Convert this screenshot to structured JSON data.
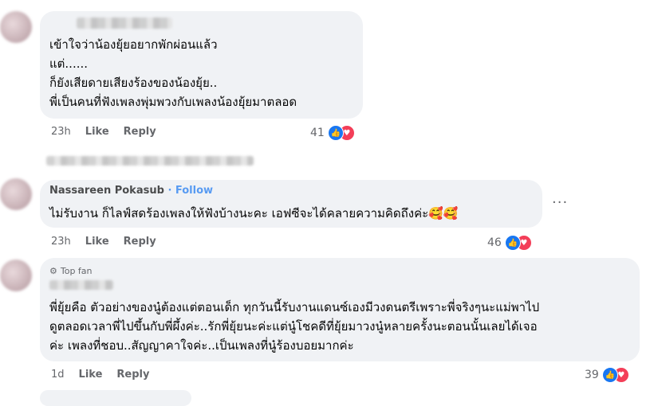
{
  "comments": [
    {
      "text": "เข้าใจว่าน้องยุ้ยอยากพักผ่อนแล้ว\nแต่......\nก็ยังเสียดายเสียงร้องของน้องยุ้ย..\nพี่เป็นคนที่ฟังเพลงพุ่มพวงกับเพลงน้องยุ้ยมาตลอด",
      "time": "23h",
      "like_label": "Like",
      "reply_label": "Reply",
      "reaction_count": "41"
    },
    {
      "author": "Nassareen Pokasub",
      "follow_label": "· Follow",
      "text": "ไม่รับงาน ก็ไลฟ์สดร้องเพลงให้ฟังบ้างนะคะ เอฟซีจะได้คลายความคิดถึงค่ะ🥰🥰",
      "time": "23h",
      "like_label": "Like",
      "reply_label": "Reply",
      "reaction_count": "46",
      "more_label": "···"
    },
    {
      "badge": "Top fan",
      "text": "พี่ยุ้ยคือ ตัวอย่างของนู๋ต้องแต่ตอนเด็ก ทุกวันนี้รับงานแดนซ์เองมีวงดนตรีเพราะพี่จริงๆนะแม่พาไป\nดูตลอดเวลาพี่ไปขึ้นกับพี่ผึ้งค่ะ..รักพี่ยุ้ยนะค่ะแต่นู๋โชคดีที่ยุ้ยมาวงนู๋หลายครั้งนะตอนนั้นเลยได้เจอ\nค่ะ เพลงที่ชอบ..สัญญาคาใจค่ะ..เป็นเพลงที่นู๋ร้องบอยมากค่ะ",
      "time": "1d",
      "like_label": "Like",
      "reply_label": "Reply",
      "reaction_count": "39"
    }
  ]
}
